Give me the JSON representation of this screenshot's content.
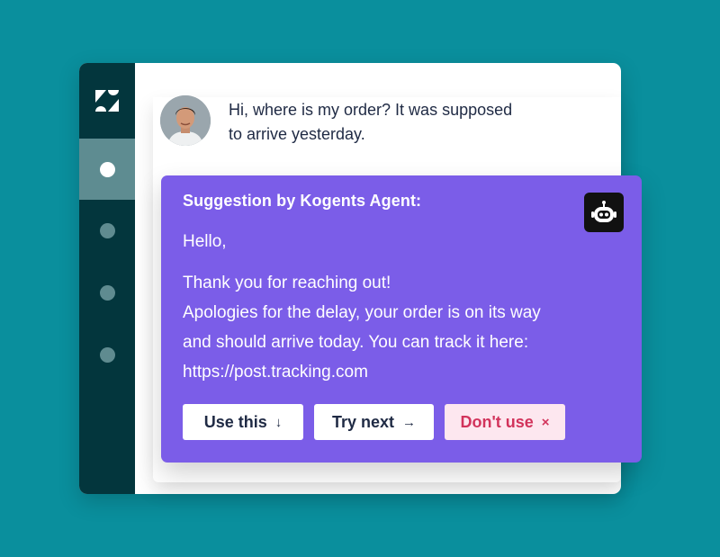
{
  "customer_message": {
    "line1": "Hi, where is my order? It was supposed",
    "line2": "to arrive yesterday."
  },
  "suggestion": {
    "header": "Suggestion by Kogents Agent:",
    "greeting": "Hello,",
    "lines": [
      "Thank you for reaching out!",
      "Apologies for the delay, your order is on its way",
      "and should arrive today. You can track it here:",
      "https://post.tracking.com"
    ],
    "actions": {
      "use_label": "Use this",
      "use_glyph": "↓",
      "try_label": "Try next",
      "try_glyph": "→",
      "dont_label": "Don't use",
      "dont_glyph": "×"
    }
  },
  "colors": {
    "background": "#0a8f9d",
    "sidebar": "#03363d",
    "suggestion_panel": "#7b5de8",
    "dont_use_text": "#d2335b"
  },
  "icons": {
    "logo": "zendesk-logo-icon",
    "bot": "robot-icon"
  }
}
